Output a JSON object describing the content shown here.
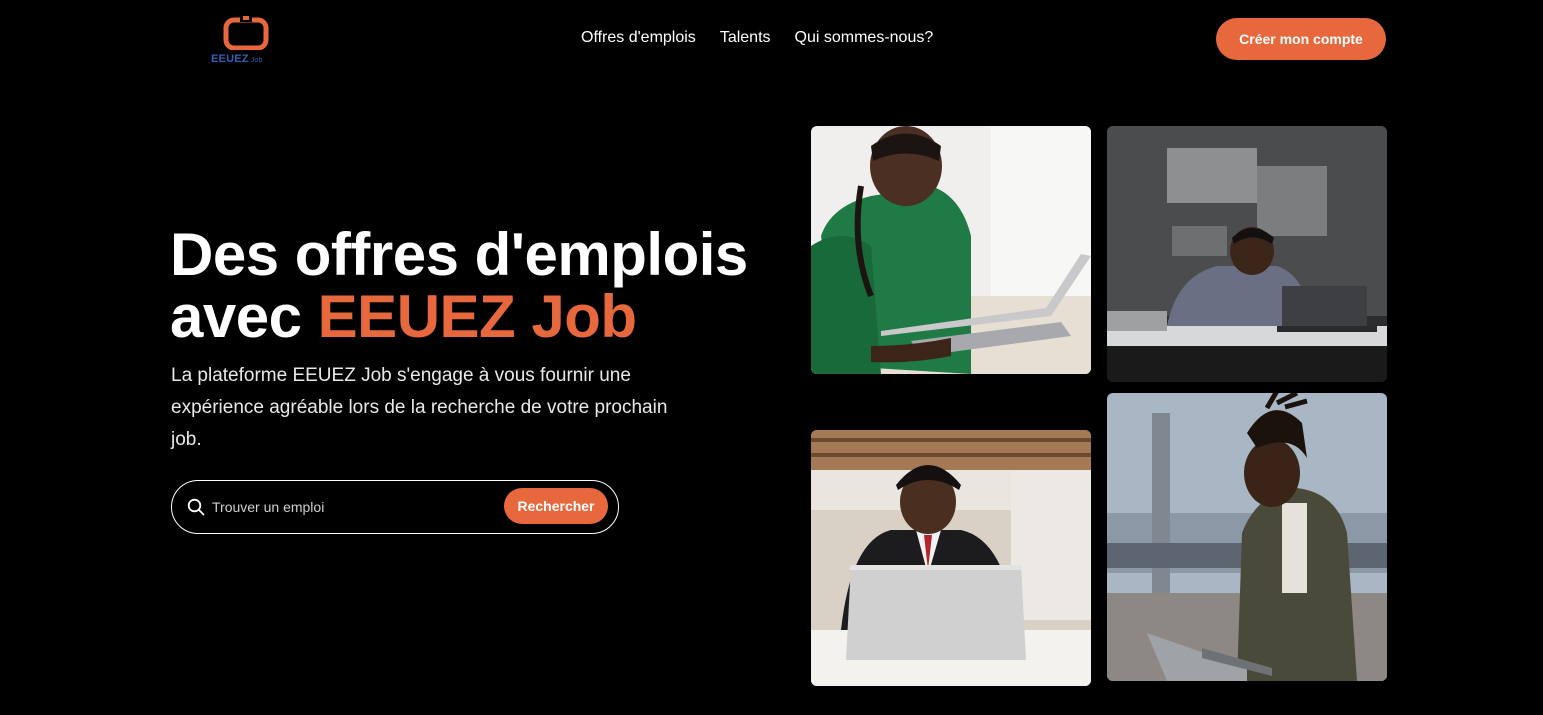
{
  "brand": {
    "name": "EEUEZ",
    "suffix": "Job",
    "accent_color": "#e8683d",
    "logo_text_color": "#2f5fb5"
  },
  "nav": {
    "items": [
      {
        "label": "Offres d'emplois"
      },
      {
        "label": "Talents"
      },
      {
        "label": "Qui sommes-nous?"
      }
    ],
    "cta_label": "Créer mon compte"
  },
  "hero": {
    "title_line1": "Des offres d'emplois",
    "title_prefix": "avec ",
    "title_accent": "EEUEZ Job",
    "description": "La plateforme EEUEZ Job s'engage à vous fournir une expérience agréable lors de la recherche de votre prochain job."
  },
  "search": {
    "placeholder": "Trouver un emploi",
    "value": "",
    "button_label": "Rechercher",
    "icon": "search-icon"
  },
  "photos": [
    {
      "icon": "photo-woman-green-shirt-laptop"
    },
    {
      "icon": "photo-man-desk-laptop-office"
    },
    {
      "icon": "photo-man-suit-headset-laptop"
    },
    {
      "icon": "photo-man-bridge-laptop"
    }
  ]
}
